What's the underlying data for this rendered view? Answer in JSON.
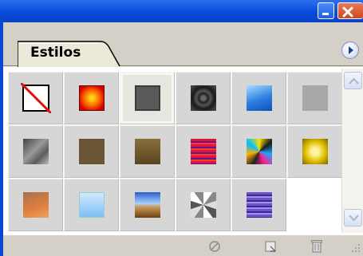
{
  "panel": {
    "tab_label": "Estilos"
  },
  "colors": {
    "titlebar": "#0a4ad9",
    "close_button": "#d0461f",
    "panel_background": "#d4d0c8",
    "cell_background": "#d6d6d6"
  },
  "styles": [
    {
      "name": "none-style",
      "icon": "no-style-icon"
    },
    {
      "name": "red-glow",
      "icon": "red-glow-swatch"
    },
    {
      "name": "dark-gray-inset",
      "icon": "dark-gray-swatch",
      "selected": true
    },
    {
      "name": "black-ring",
      "icon": "black-ring-swatch"
    },
    {
      "name": "blue-gradient",
      "icon": "blue-gradient-swatch"
    },
    {
      "name": "light-gray",
      "icon": "light-gray-swatch"
    },
    {
      "name": "gray-metal",
      "icon": "gray-metal-swatch"
    },
    {
      "name": "brown-square",
      "icon": "brown-swatch"
    },
    {
      "name": "olive-gradient",
      "icon": "olive-gradient-swatch"
    },
    {
      "name": "red-stripes",
      "icon": "red-stripes-swatch"
    },
    {
      "name": "multicolor-blocks",
      "icon": "multicolor-swatch"
    },
    {
      "name": "gold-frame",
      "icon": "gold-swatch"
    },
    {
      "name": "sunset-gradient",
      "icon": "sunset-swatch"
    },
    {
      "name": "light-blue",
      "icon": "light-blue-swatch"
    },
    {
      "name": "landscape",
      "icon": "landscape-swatch"
    },
    {
      "name": "noise-texture",
      "icon": "noise-swatch"
    },
    {
      "name": "purple-stripes",
      "icon": "purple-stripes-swatch"
    }
  ],
  "bottom_icons": [
    "clear-style-icon",
    "new-style-icon",
    "delete-style-icon"
  ],
  "scrollbar": {
    "up": "scroll-up-icon",
    "down": "scroll-down-icon"
  }
}
